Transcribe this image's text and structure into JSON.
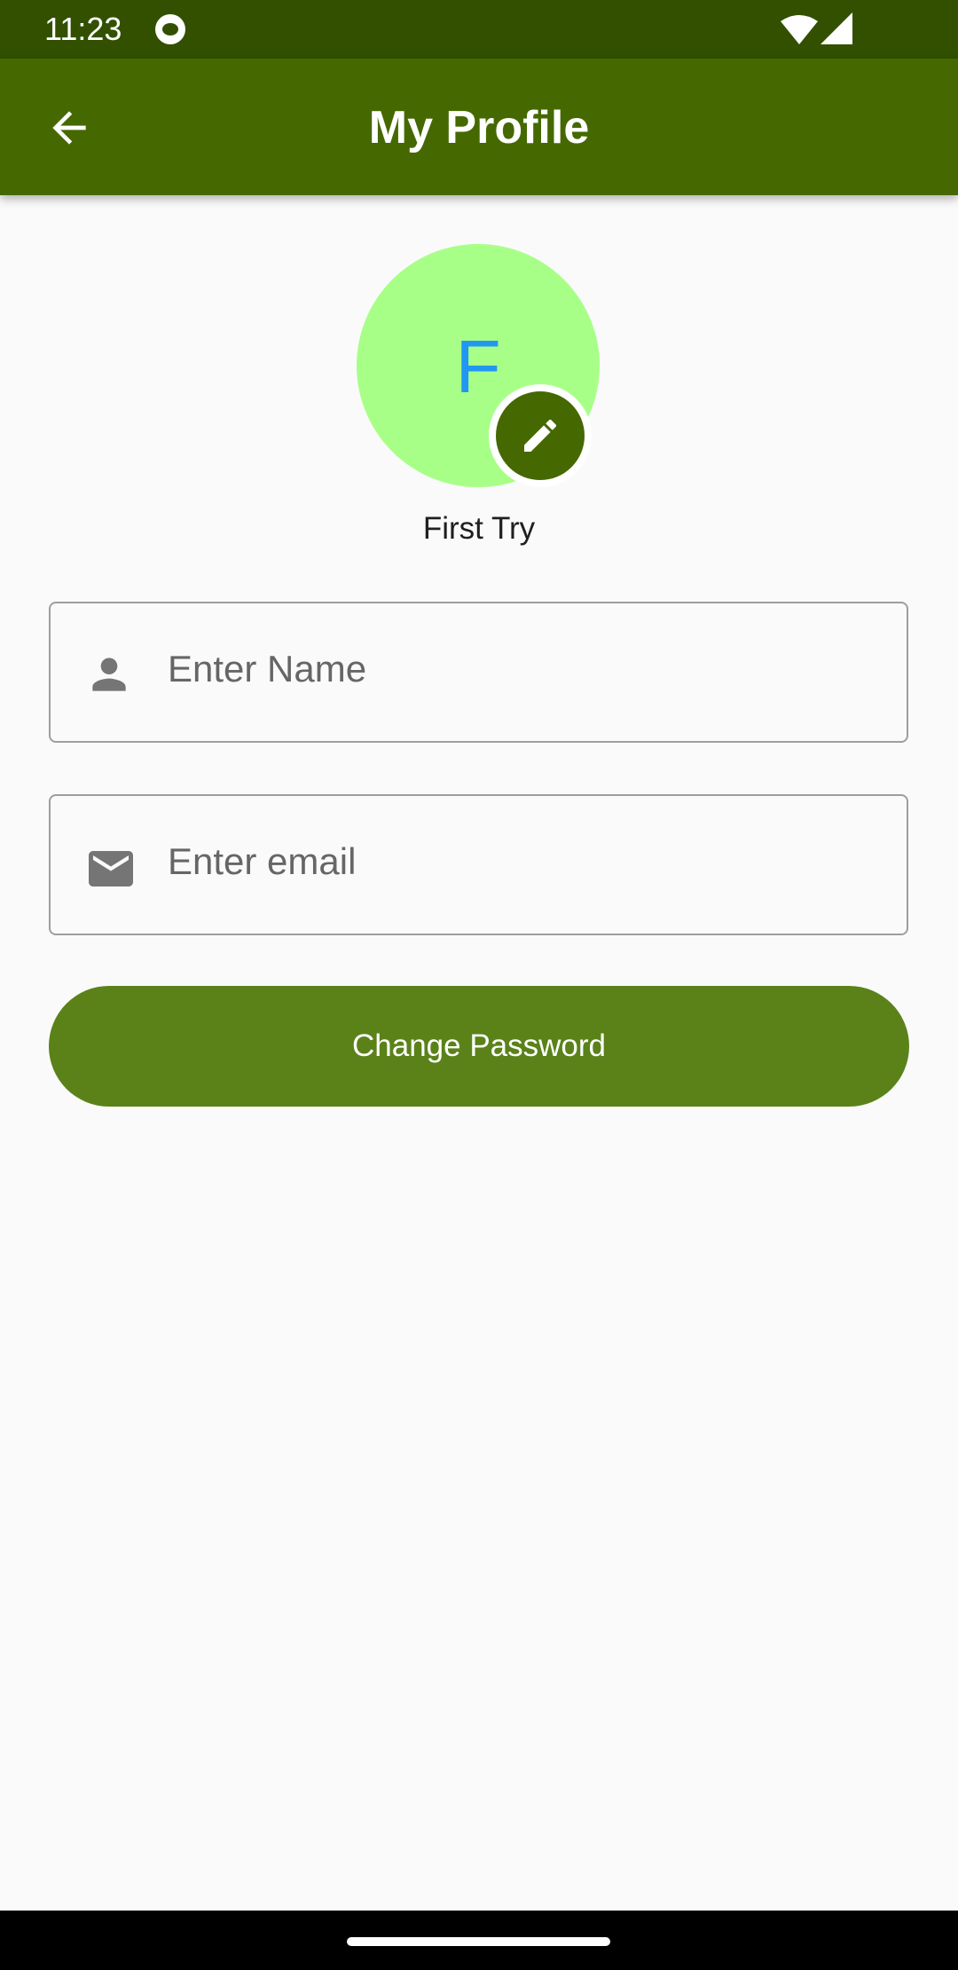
{
  "status_bar": {
    "time": "11:23",
    "icons": [
      "cat-notification-icon",
      "wifi-icon",
      "cell-signal-icon"
    ]
  },
  "app_bar": {
    "title": "My Profile",
    "back_icon": "arrow-back-icon"
  },
  "profile": {
    "initial": "F",
    "name": "First Try",
    "avatar_color": "#a8ff88",
    "initial_color": "#2196f3",
    "edit_icon": "pencil-icon"
  },
  "form": {
    "name_field": {
      "placeholder": "Enter Name",
      "value": "",
      "icon": "person-icon"
    },
    "email_field": {
      "placeholder": "Enter email",
      "value": "",
      "icon": "mail-icon"
    },
    "change_password_label": "Change Password"
  },
  "colors": {
    "primary": "#456900",
    "status_bar": "#325000",
    "button": "#5a8219"
  }
}
